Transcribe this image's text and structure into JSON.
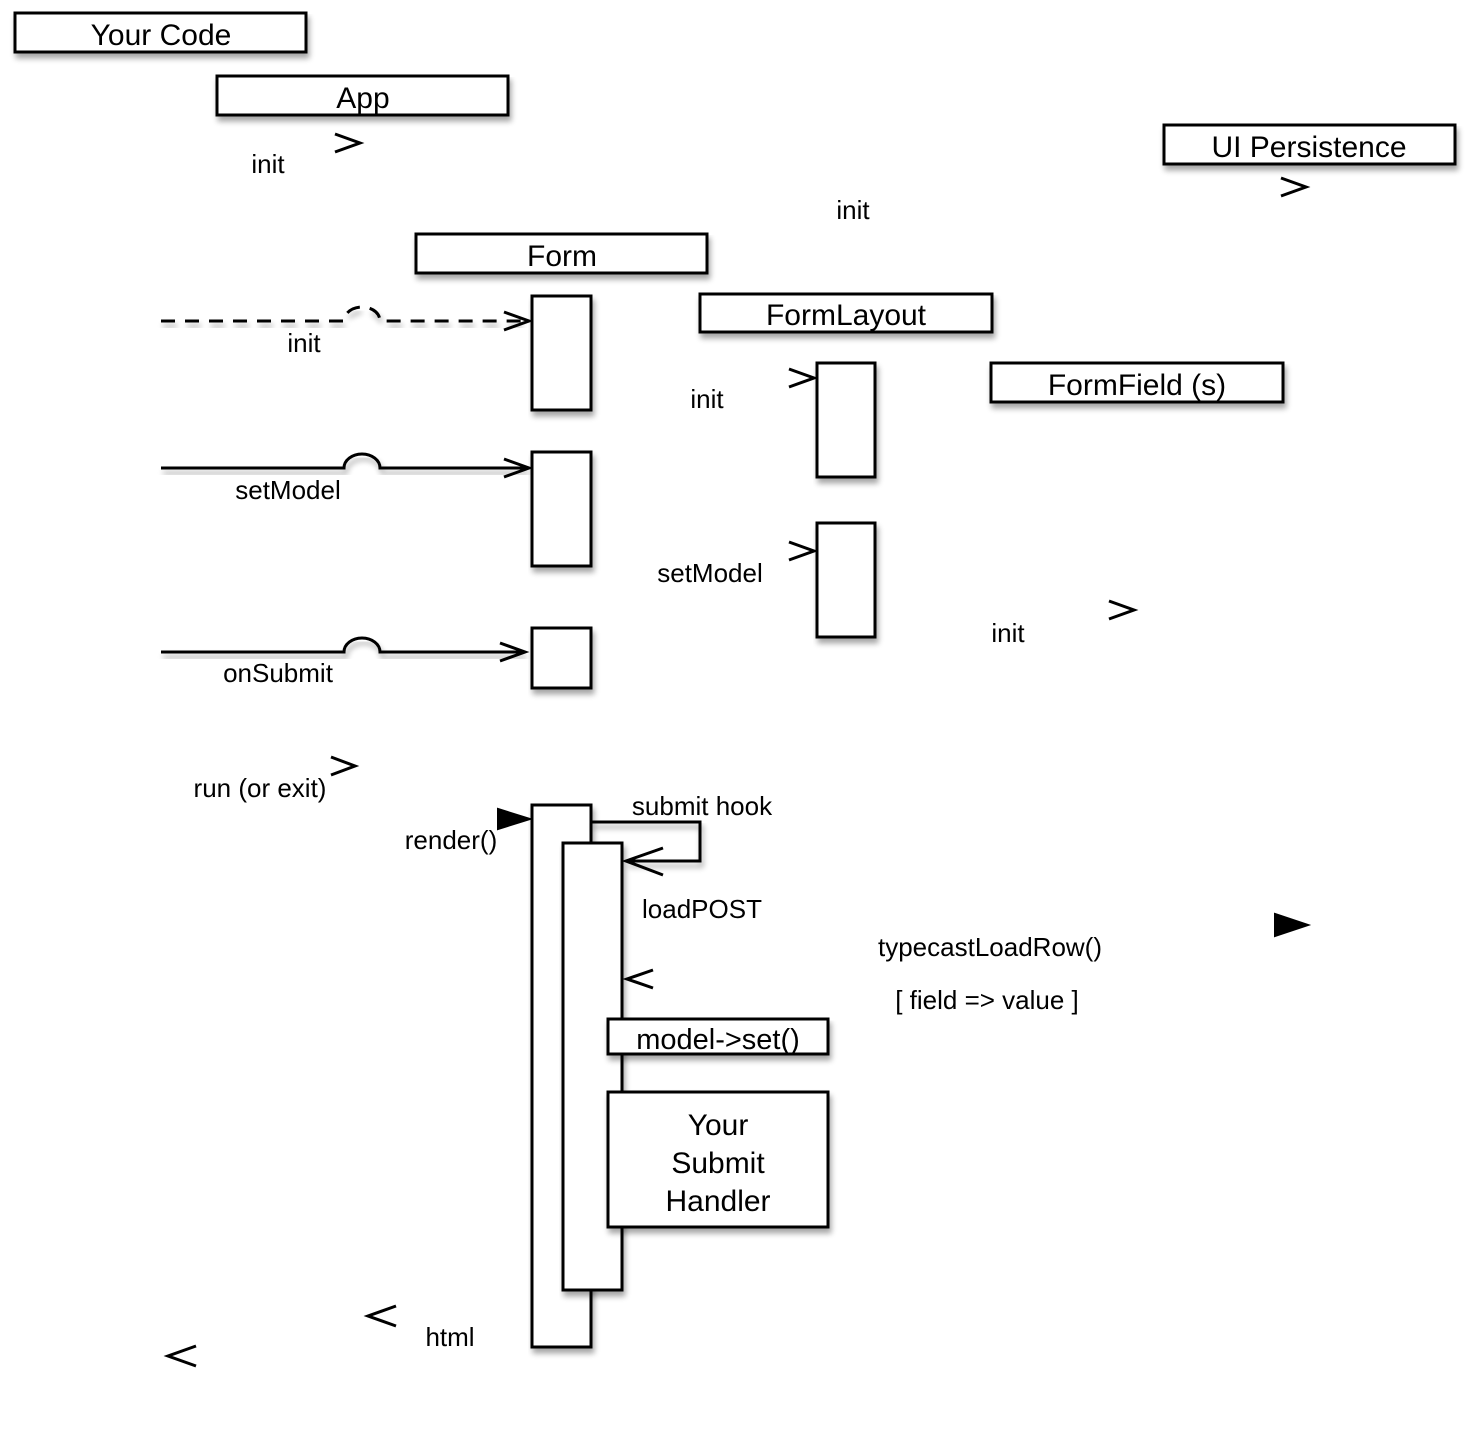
{
  "diagram": {
    "type": "UML sequence diagram",
    "participants": [
      {
        "id": "your_code",
        "label": "Your Code"
      },
      {
        "id": "app",
        "label": "App"
      },
      {
        "id": "ui_persistence",
        "label": "UI Persistence"
      },
      {
        "id": "form",
        "label": "Form"
      },
      {
        "id": "form_layout",
        "label": "FormLayout"
      },
      {
        "id": "form_fields",
        "label": "FormField (s)"
      }
    ],
    "messages": [
      {
        "id": "m1",
        "from": "your_code",
        "to": "app",
        "label": "init",
        "style": "dashed",
        "arrow": "open"
      },
      {
        "id": "m2",
        "from": "app",
        "to": "ui_persistence",
        "label": "init",
        "style": "dashed",
        "arrow": "open"
      },
      {
        "id": "m3",
        "from": "your_code",
        "to": "form",
        "label": "init",
        "style": "dashed",
        "arrow": "open"
      },
      {
        "id": "m4",
        "from": "form",
        "to": "form_layout",
        "label": "init",
        "style": "dashed",
        "arrow": "open"
      },
      {
        "id": "m5",
        "from": "your_code",
        "to": "form",
        "label": "setModel",
        "style": "solid",
        "arrow": "open"
      },
      {
        "id": "m6",
        "from": "form",
        "to": "form_layout",
        "label": "setModel",
        "style": "solid",
        "arrow": "open"
      },
      {
        "id": "m7",
        "from": "form_layout",
        "to": "form_fields",
        "label": "init",
        "style": "dashed",
        "arrow": "open"
      },
      {
        "id": "m8",
        "from": "your_code",
        "to": "form",
        "label": "onSubmit",
        "style": "solid",
        "arrow": "open"
      },
      {
        "id": "m9",
        "from": "your_code",
        "to": "app",
        "label": "run (or exit)",
        "style": "solid",
        "arrow": "open"
      },
      {
        "id": "m10",
        "from": "app",
        "to": "form",
        "label": "render()",
        "style": "solid",
        "arrow": "filled"
      },
      {
        "id": "m11",
        "from": "form",
        "to": "form",
        "label": "submit hook",
        "style": "solid",
        "arrow": "open",
        "self": true
      },
      {
        "id": "m12",
        "from": "form",
        "to": "ui_persistence",
        "label": "loadPOST",
        "style": "solid",
        "arrow": "filled"
      },
      {
        "id": "m13",
        "from": "ui_persistence",
        "to": "form",
        "label": "typecastLoadRow()",
        "style": "dashed",
        "arrow": "open"
      },
      {
        "id": "m14",
        "from": "form",
        "to": "app",
        "label": "html",
        "style": "dashed",
        "arrow": "open"
      },
      {
        "id": "m15",
        "from": "app",
        "to": "your_code",
        "label": "",
        "style": "dashed",
        "arrow": "open"
      }
    ],
    "notes": {
      "return_value": "[ field => value ]",
      "model_set": "model->set()",
      "submit_handler": [
        "Your",
        "Submit",
        "Handler"
      ]
    }
  }
}
